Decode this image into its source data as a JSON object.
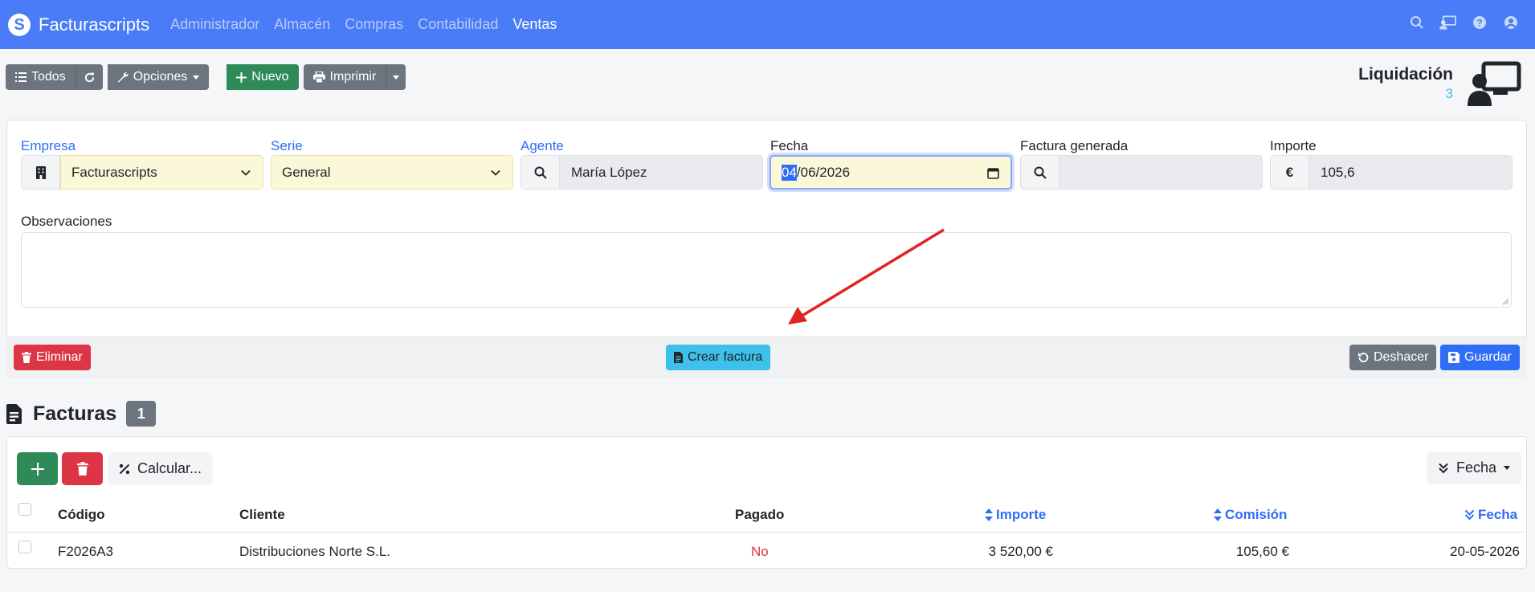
{
  "navbar": {
    "brand": "Facturascripts",
    "links": [
      {
        "label": "Administrador",
        "active": false
      },
      {
        "label": "Almacén",
        "active": false
      },
      {
        "label": "Compras",
        "active": false
      },
      {
        "label": "Contabilidad",
        "active": false
      },
      {
        "label": "Ventas",
        "active": true
      }
    ],
    "icons": [
      "search-icon",
      "screen-share-icon",
      "help-icon",
      "user-icon"
    ]
  },
  "toolbar": {
    "todos_label": "Todos",
    "opciones_label": "Opciones",
    "nuevo_label": "Nuevo",
    "imprimir_label": "Imprimir"
  },
  "header": {
    "title": "Liquidación",
    "number": "3"
  },
  "form": {
    "empresa_label": "Empresa",
    "empresa_value": "Facturascripts",
    "serie_label": "Serie",
    "serie_value": "General",
    "agente_label": "Agente",
    "agente_value": "María López",
    "fecha_label": "Fecha",
    "fecha_day": "04",
    "fecha_rest": "/06/2026",
    "factura_label": "Factura generada",
    "factura_value": "",
    "importe_label": "Importe",
    "importe_currency": "€",
    "importe_value": "105,6",
    "observaciones_label": "Observaciones",
    "observaciones_value": ""
  },
  "footer": {
    "eliminar_label": "Eliminar",
    "crear_label": "Crear factura",
    "deshacer_label": "Deshacer",
    "guardar_label": "Guardar"
  },
  "facturas": {
    "title": "Facturas",
    "count": "1",
    "calcular_label": "Calcular...",
    "order_label": "Fecha",
    "columns": {
      "codigo": "Código",
      "cliente": "Cliente",
      "pagado": "Pagado",
      "importe": "Importe",
      "comision": "Comisión",
      "fecha": "Fecha"
    },
    "rows": [
      {
        "codigo": "F2026A3",
        "cliente": "Distribuciones Norte S.L.",
        "pagado": "No",
        "importe": "3 520,00 €",
        "comision": "105,60 €",
        "fecha": "20-05-2026"
      }
    ]
  },
  "colors": {
    "navbar": "#4a7cf7",
    "primary": "#2f6df6",
    "success": "#2e8b57",
    "danger": "#dc3545",
    "info": "#3dc0ea",
    "secondary": "#6c757d",
    "annotation_arrow": "#e02424"
  }
}
